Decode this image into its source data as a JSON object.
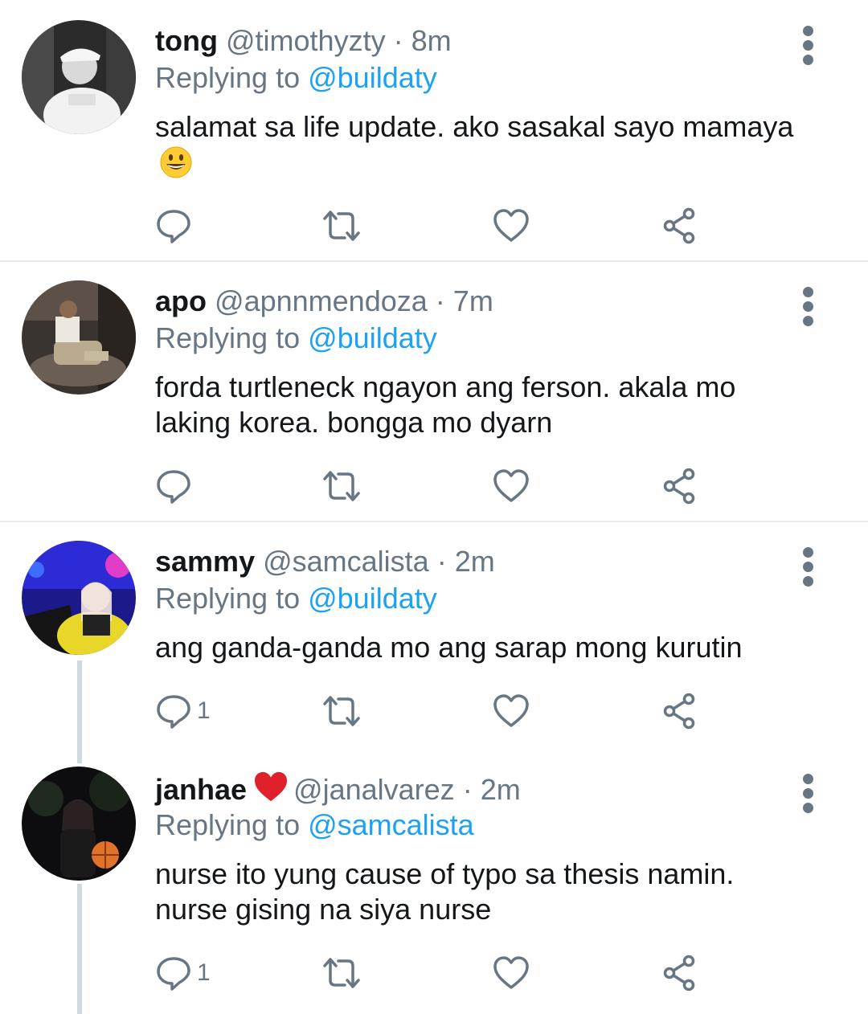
{
  "colors": {
    "text": "#14171a",
    "muted": "#687684",
    "accent": "#1da1f2",
    "divider": "#e6ecf0",
    "thread": "#cfd9de"
  },
  "tweets": [
    {
      "name": "tong",
      "handle": "@timothyzty",
      "sep": "·",
      "time": "8m",
      "replying_prefix": "Replying to ",
      "replying_to": "@buildaty",
      "text": "salamat sa life update. ako sasakal sayo mamaya",
      "emoji": "grinning-face",
      "reply_count": "",
      "avatar_icon": "avatar-photo"
    },
    {
      "name": "apo",
      "handle": "@apnnmendoza",
      "sep": "·",
      "time": "7m",
      "replying_prefix": "Replying to ",
      "replying_to": "@buildaty",
      "text": "forda turtleneck ngayon ang ferson. akala mo laking korea. bongga mo dyarn",
      "reply_count": "",
      "avatar_icon": "avatar-photo"
    },
    {
      "name": "sammy",
      "handle": "@samcalista",
      "sep": "·",
      "time": "2m",
      "replying_prefix": "Replying to ",
      "replying_to": "@buildaty",
      "text": "ang ganda-ganda mo ang sarap mong kurutin",
      "reply_count": "1",
      "avatar_icon": "avatar-photo"
    },
    {
      "name": "janhae",
      "name_badge": "red-heart-icon",
      "handle": "@janalvarez",
      "sep": "·",
      "time": "2m",
      "replying_prefix": "Replying to ",
      "replying_to": "@samcalista",
      "text": "nurse ito yung cause of typo sa thesis namin. nurse gising na siya nurse",
      "reply_count": "1",
      "avatar_icon": "avatar-photo"
    }
  ],
  "action_icons": [
    "reply-icon",
    "retweet-icon",
    "like-icon",
    "share-icon"
  ]
}
